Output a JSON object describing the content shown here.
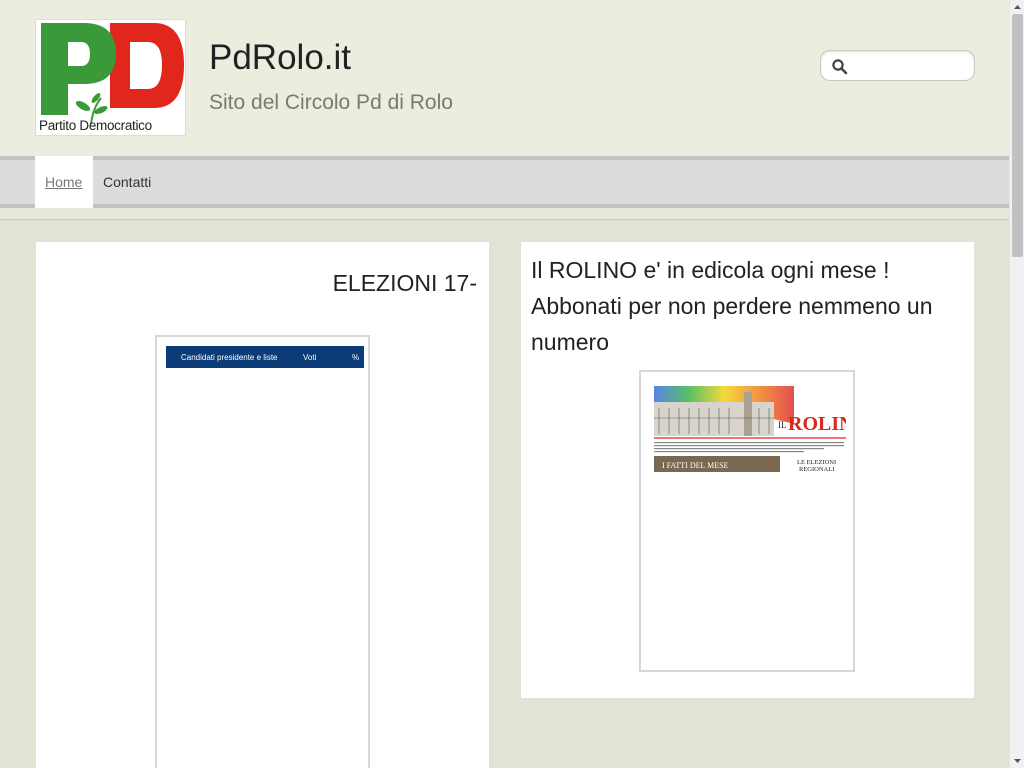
{
  "header": {
    "logo": {
      "letters": "PD",
      "text_line": "Partito Democratico",
      "colors": {
        "green": "#3a9a3a",
        "red": "#e1261c"
      }
    },
    "site_title": "PdRolo.it",
    "site_subtitle": "Sito del Circolo Pd di Rolo",
    "search": {
      "placeholder": "",
      "value": "",
      "icon": "search-icon"
    }
  },
  "nav": {
    "items": [
      {
        "label": "Home",
        "active": true
      },
      {
        "label": "Contatti",
        "active": false
      }
    ]
  },
  "left_panel": {
    "heading": "ELEZIONI 17-",
    "results_table": {
      "header_color": "#0b3c78",
      "columns": [
        "Candidati presidente e liste",
        "Voti",
        "%"
      ]
    }
  },
  "right_panel": {
    "text": "Il ROLINO e' in edicola ogni mese ! Abbonati per non perdere nemmeno un numero",
    "magazine": {
      "masthead": "IL ROLINO",
      "section_left": "I FATTI DEL MESE",
      "section_right": "LE ELEZIONI REGIONALI"
    }
  },
  "colors": {
    "page_bg": "#e2e2d5",
    "header_bg": "#ececdf",
    "nav_bg": "#dcdcdc",
    "table_header": "#0b3c78"
  }
}
